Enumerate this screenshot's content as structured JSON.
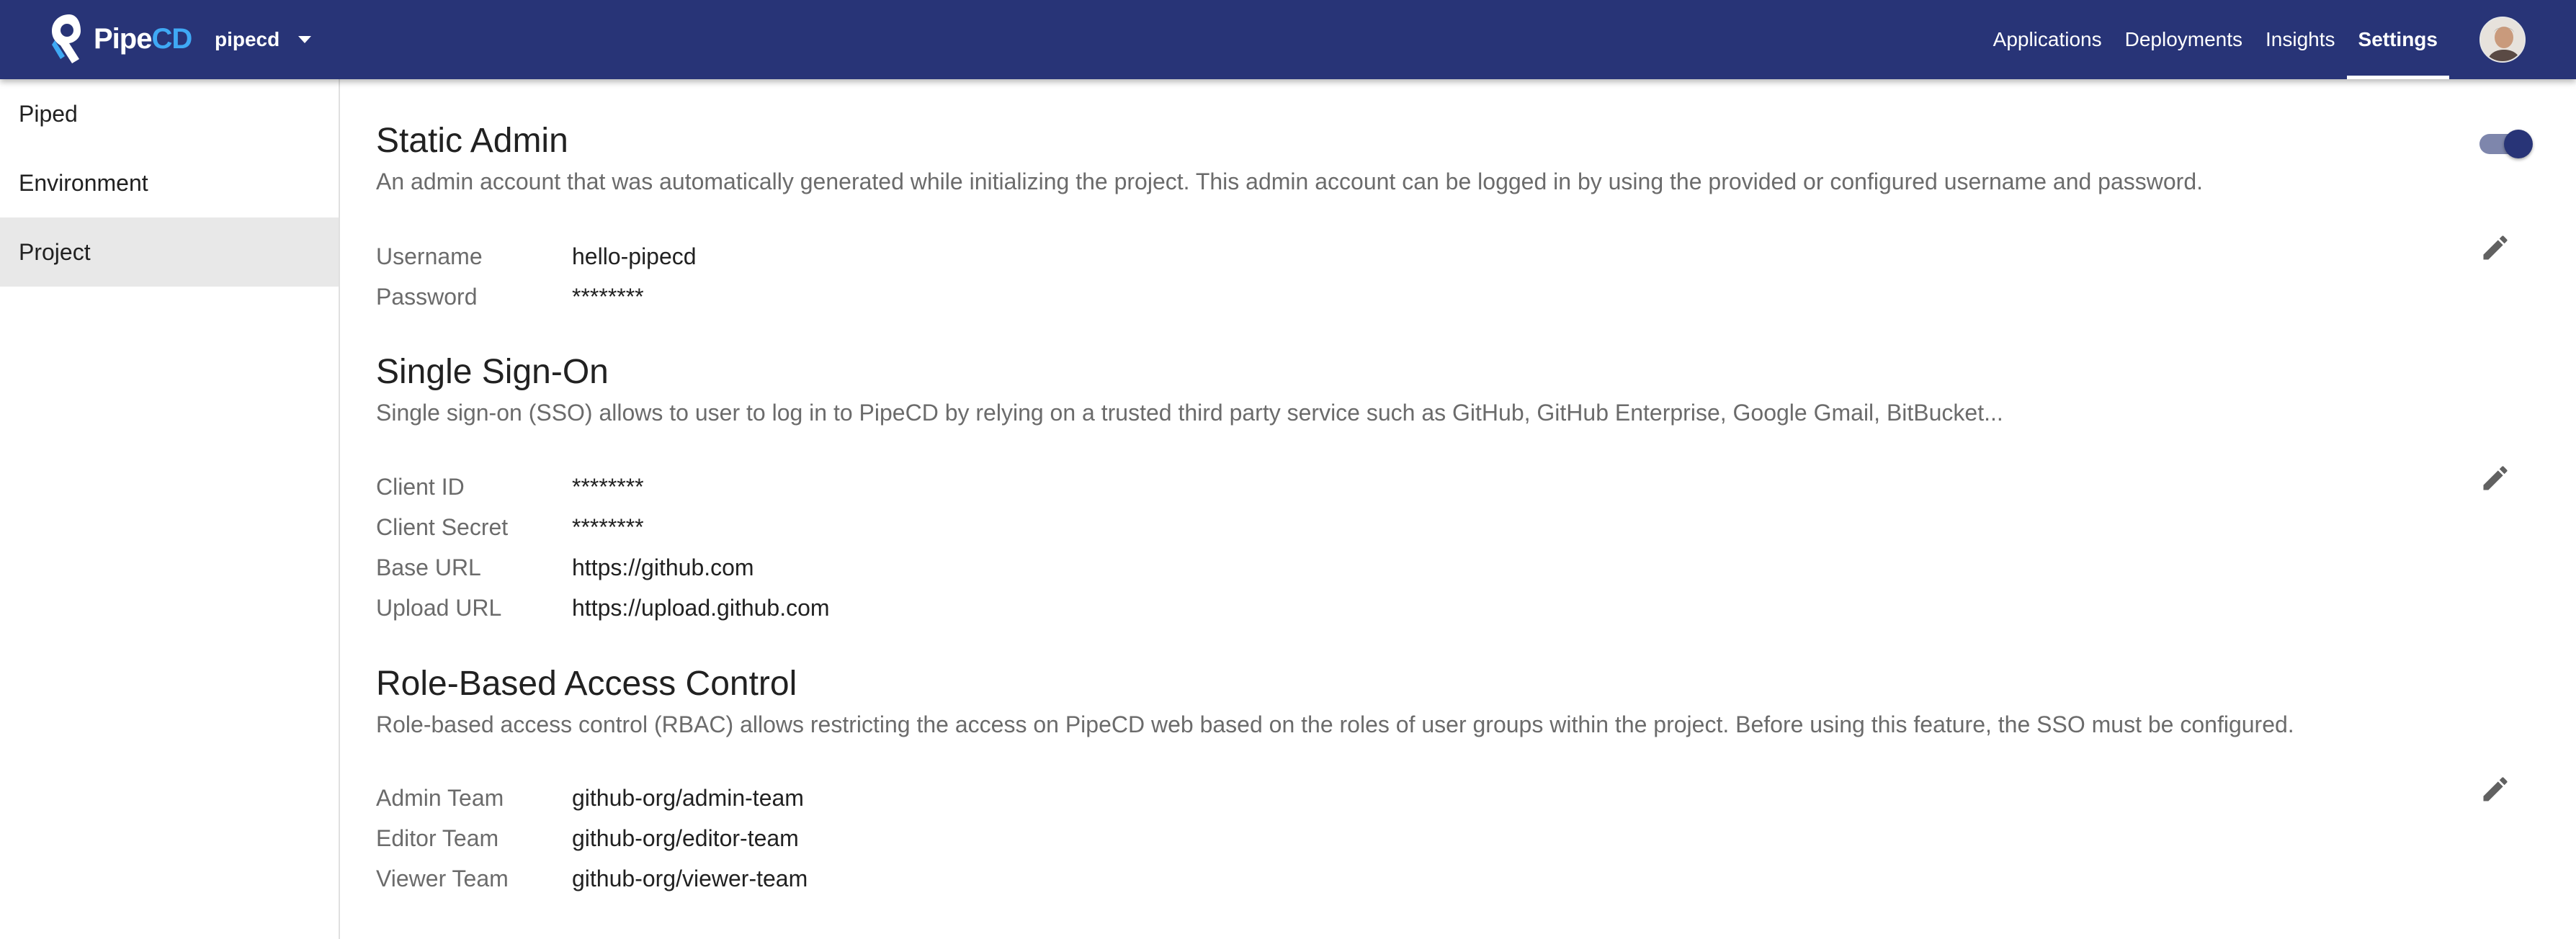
{
  "header": {
    "logo": {
      "text_pipe": "Pipe",
      "text_cd": "CD",
      "icon": "pipecd-logo"
    },
    "project": {
      "name": "pipecd",
      "icon": "arrow-drop-down-icon"
    },
    "nav": [
      {
        "label": "Applications",
        "active": false
      },
      {
        "label": "Deployments",
        "active": false
      },
      {
        "label": "Insights",
        "active": false
      },
      {
        "label": "Settings",
        "active": true
      }
    ],
    "avatar_icon": "user-avatar"
  },
  "sidebar": {
    "items": [
      {
        "label": "Piped",
        "selected": false
      },
      {
        "label": "Environment",
        "selected": false
      },
      {
        "label": "Project",
        "selected": true
      }
    ]
  },
  "static_admin": {
    "title": "Static Admin",
    "description": "An admin account that was automatically generated while initializing the project. This admin account can be logged in by using the provided or configured username and password.",
    "enabled": true,
    "fields": [
      {
        "label": "Username",
        "value": "hello-pipecd"
      },
      {
        "label": "Password",
        "value": "********"
      }
    ],
    "edit_icon": "pencil-icon"
  },
  "sso": {
    "title": "Single Sign-On",
    "description": "Single sign-on (SSO) allows to user to log in to PipeCD by relying on a trusted third party service such as GitHub, GitHub Enterprise, Google Gmail, BitBucket...",
    "fields": [
      {
        "label": "Client ID",
        "value": "********"
      },
      {
        "label": "Client Secret",
        "value": "********"
      },
      {
        "label": "Base URL",
        "value": "https://github.com"
      },
      {
        "label": "Upload URL",
        "value": "https://upload.github.com"
      }
    ],
    "edit_icon": "pencil-icon"
  },
  "rbac": {
    "title": "Role-Based Access Control",
    "description": "Role-based access control (RBAC) allows restricting the access on PipeCD web based on the roles of user groups within the project. Before using this feature, the SSO must be configured.",
    "fields": [
      {
        "label": "Admin Team",
        "value": "github-org/admin-team"
      },
      {
        "label": "Editor Team",
        "value": "github-org/editor-team"
      },
      {
        "label": "Viewer Team",
        "value": "github-org/viewer-team"
      }
    ],
    "edit_icon": "pencil-icon"
  },
  "colors": {
    "appbar": "#283477",
    "toggle_thumb": "#283477",
    "toggle_track": "#7e86ac",
    "sidebar_selected": "#e8e8e8",
    "secondary_text": "#6b6b6b"
  }
}
